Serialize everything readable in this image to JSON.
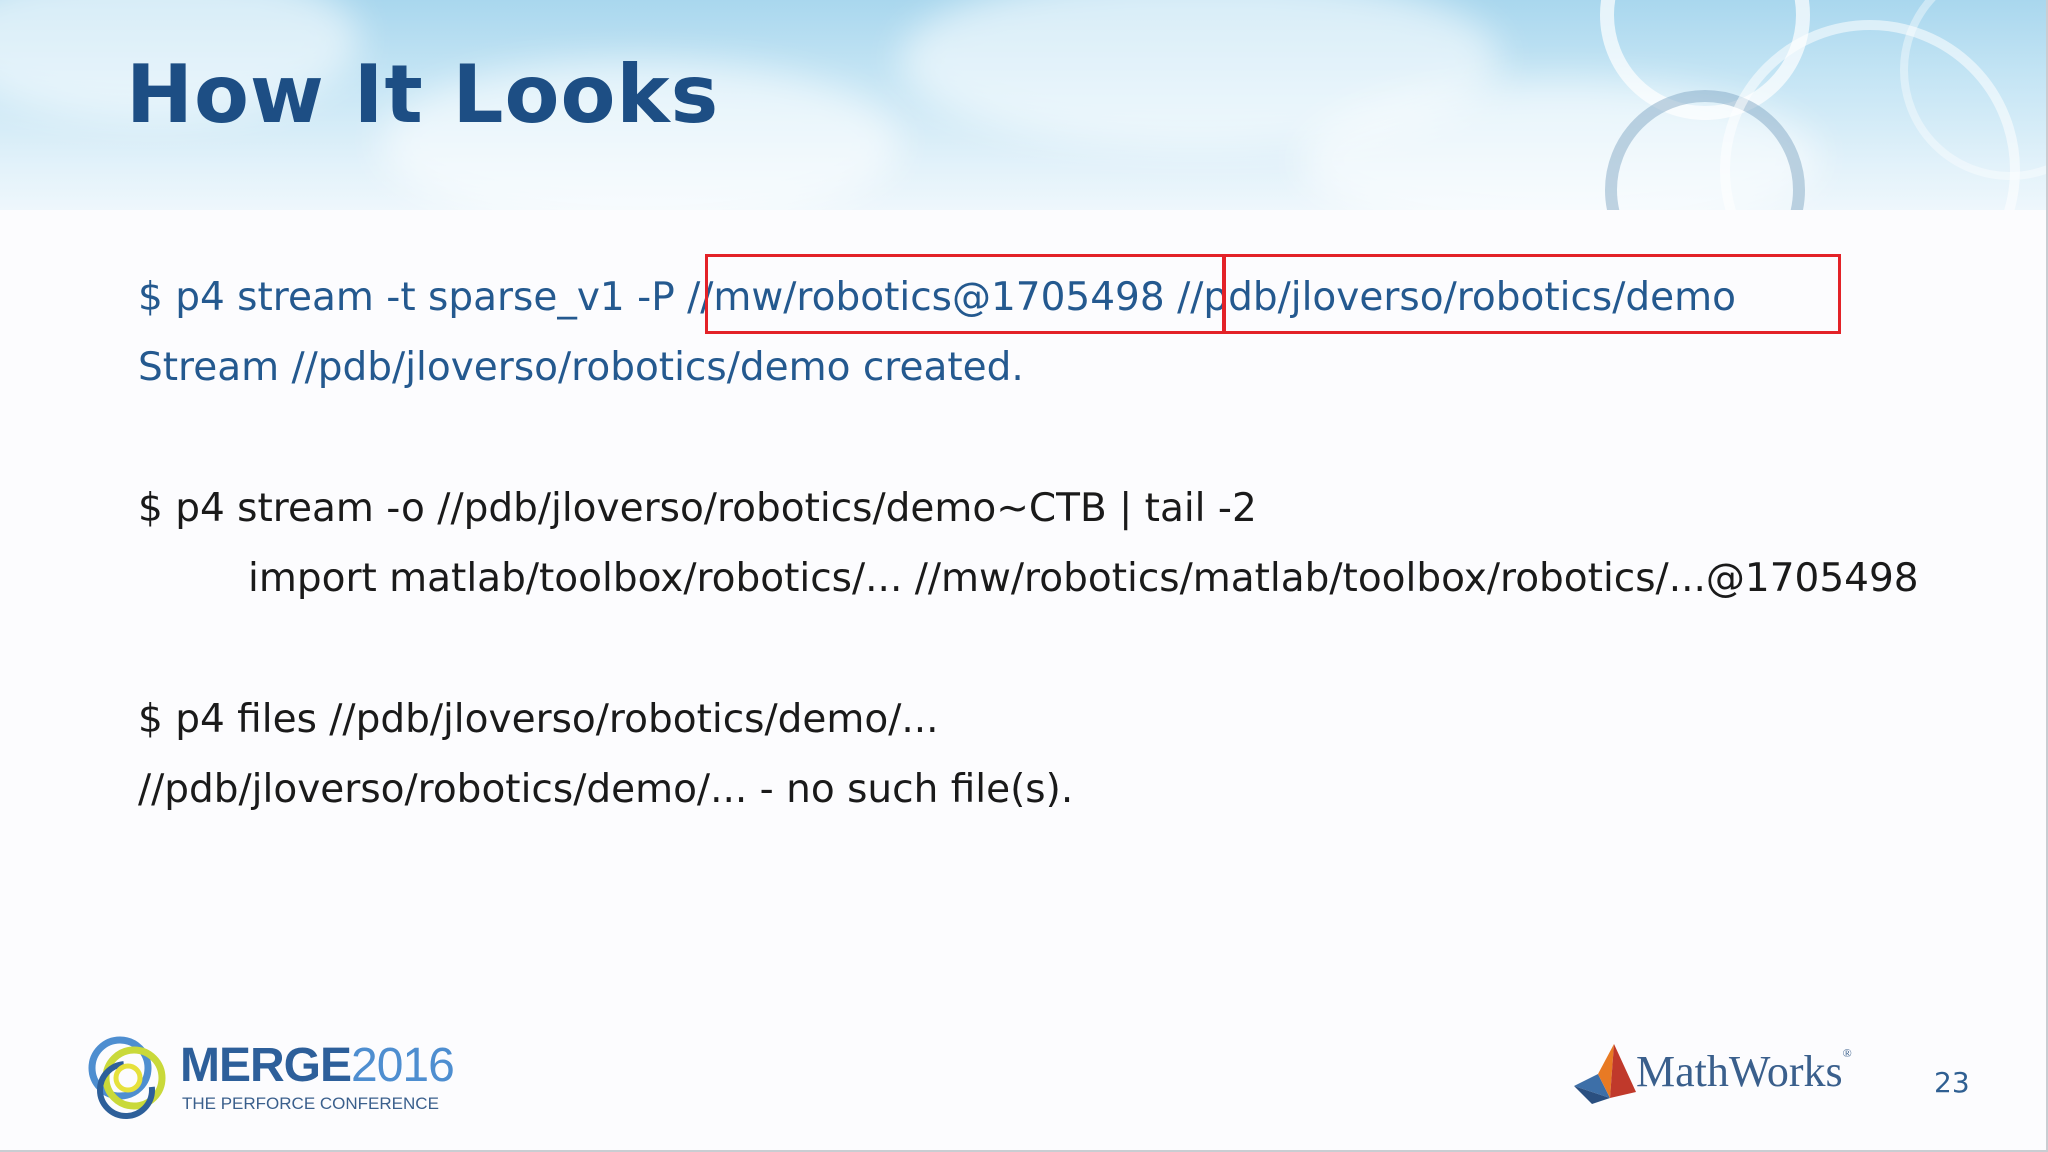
{
  "slide": {
    "title": "How It Looks",
    "commands": {
      "line1_prefix": "$ p4 stream -t sparse_v1 -P ",
      "line1_parent": "//mw/robotics@1705498",
      "line1_stream": "//pdb/jloverso/robotics/demo",
      "line2": "Stream //pdb/jloverso/robotics/demo created.",
      "line3": "$ p4 stream -o //pdb/jloverso/robotics/demo~CTB | tail -2",
      "line4": "import matlab/toolbox/robotics/... //mw/robotics/matlab/toolbox/robotics/...@1705498",
      "line5": "$ p4 files //pdb/jloverso/robotics/demo/...",
      "line6": "//pdb/jloverso/robotics/demo/... - no such file(s)."
    },
    "colors": {
      "title": "#1d4e84",
      "output_blue": "#24598f",
      "highlight_box": "#e32228"
    },
    "footer": {
      "merge_logo_word": "MERGE",
      "merge_logo_year": "2016",
      "merge_logo_sub": "THE PERFORCE CONFERENCE",
      "mathworks_logo": "MathWorks",
      "mathworks_tm": "®",
      "page_number": "23"
    }
  }
}
